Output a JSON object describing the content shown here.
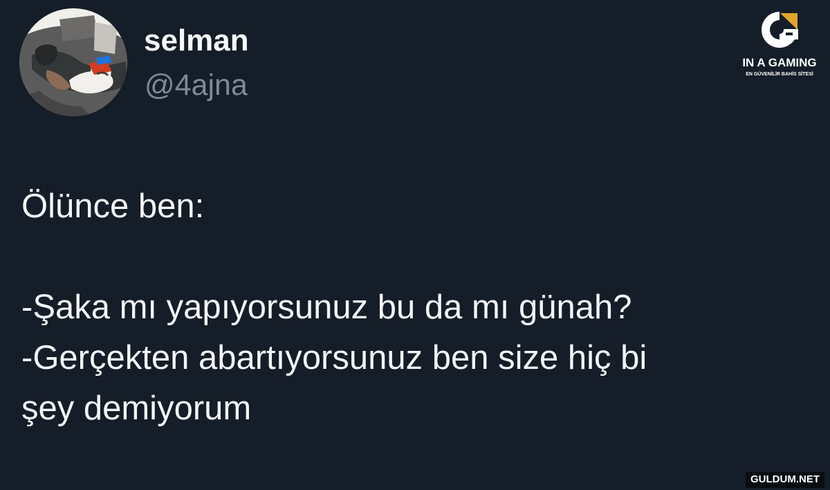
{
  "tweet": {
    "author": {
      "display_name": "selman",
      "handle": "@4ajna",
      "avatar": "profile-photo"
    },
    "text": "Ölünce ben:\n\n-Şaka mı yapıyorsunuz bu da mı günah?\n-Gerçekten abartıyorsunuz ben size hiç bi\nşey demiyorum"
  },
  "brand": {
    "name": "IN A GAMING",
    "tagline": "EN GÜVENİLİR BAHİS SİTESİ",
    "accent_color": "#e3a42c",
    "icon": "g-logo-icon"
  },
  "watermark": {
    "text": "GULDUM.NET"
  },
  "colors": {
    "background": "#151d28",
    "primary_text": "#f4f6f8",
    "secondary_text": "#7d8a95"
  }
}
